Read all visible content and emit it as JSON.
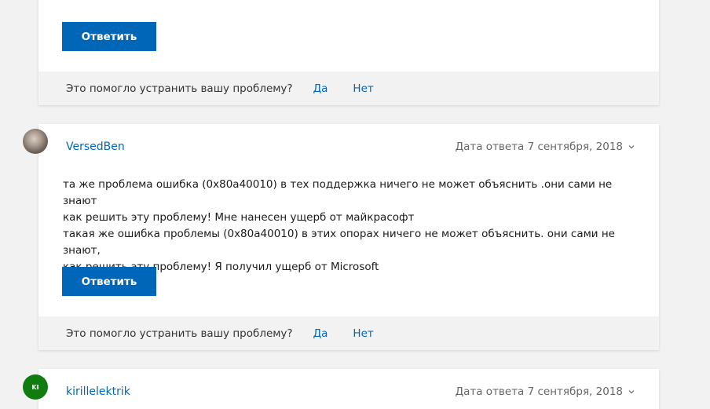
{
  "reply_label": "Ответить",
  "feedback": {
    "question": "Это помогло устранить вашу проблему?",
    "yes": "Да",
    "no": "Нет"
  },
  "posts": [
    {
      "author": "VersedBen",
      "date": "Дата ответа 7 сентября, 2018",
      "lines": [
        "та же проблема ошибка (0x80a40010) в тех поддержка ничего не может объяснить .они сами не знают",
        "как решить эту проблему! Мне нанесен ущерб от майкрасофт",
        "такая же ошибка проблемы (0x80a40010) в этих опорах ничего не может объяснить. они сами не знают,",
        "как решить эту проблему! Я получил ущерб от Microsoft"
      ]
    },
    {
      "author": "kirillelektrik",
      "avatar_initials": "KI",
      "avatar_color": "#107c10",
      "date": "Дата ответа 7 сентября, 2018"
    }
  ],
  "colors": {
    "accent": "#0067b8",
    "background": "#f2f2f2",
    "feedback_bar": "#f2f2f2"
  }
}
